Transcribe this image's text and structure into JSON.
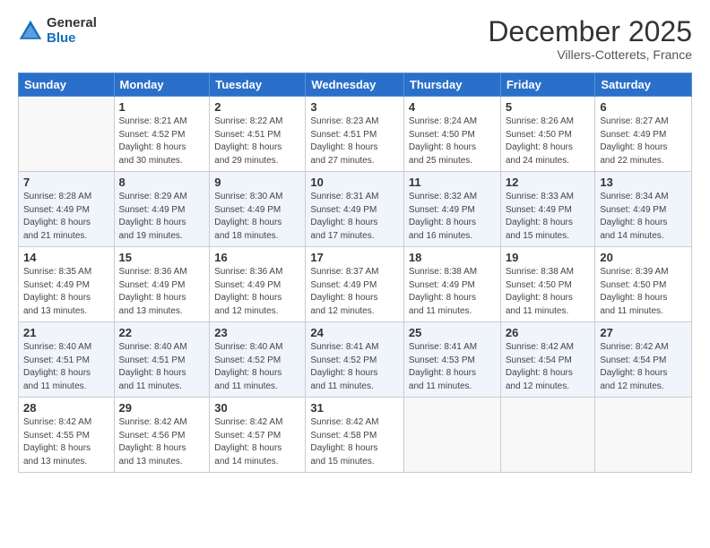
{
  "logo": {
    "general": "General",
    "blue": "Blue"
  },
  "header": {
    "month": "December 2025",
    "location": "Villers-Cotterets, France"
  },
  "days_of_week": [
    "Sunday",
    "Monday",
    "Tuesday",
    "Wednesday",
    "Thursday",
    "Friday",
    "Saturday"
  ],
  "weeks": [
    {
      "days": [
        {
          "num": "",
          "info": ""
        },
        {
          "num": "1",
          "info": "Sunrise: 8:21 AM\nSunset: 4:52 PM\nDaylight: 8 hours\nand 30 minutes."
        },
        {
          "num": "2",
          "info": "Sunrise: 8:22 AM\nSunset: 4:51 PM\nDaylight: 8 hours\nand 29 minutes."
        },
        {
          "num": "3",
          "info": "Sunrise: 8:23 AM\nSunset: 4:51 PM\nDaylight: 8 hours\nand 27 minutes."
        },
        {
          "num": "4",
          "info": "Sunrise: 8:24 AM\nSunset: 4:50 PM\nDaylight: 8 hours\nand 25 minutes."
        },
        {
          "num": "5",
          "info": "Sunrise: 8:26 AM\nSunset: 4:50 PM\nDaylight: 8 hours\nand 24 minutes."
        },
        {
          "num": "6",
          "info": "Sunrise: 8:27 AM\nSunset: 4:49 PM\nDaylight: 8 hours\nand 22 minutes."
        }
      ]
    },
    {
      "days": [
        {
          "num": "7",
          "info": "Sunrise: 8:28 AM\nSunset: 4:49 PM\nDaylight: 8 hours\nand 21 minutes."
        },
        {
          "num": "8",
          "info": "Sunrise: 8:29 AM\nSunset: 4:49 PM\nDaylight: 8 hours\nand 19 minutes."
        },
        {
          "num": "9",
          "info": "Sunrise: 8:30 AM\nSunset: 4:49 PM\nDaylight: 8 hours\nand 18 minutes."
        },
        {
          "num": "10",
          "info": "Sunrise: 8:31 AM\nSunset: 4:49 PM\nDaylight: 8 hours\nand 17 minutes."
        },
        {
          "num": "11",
          "info": "Sunrise: 8:32 AM\nSunset: 4:49 PM\nDaylight: 8 hours\nand 16 minutes."
        },
        {
          "num": "12",
          "info": "Sunrise: 8:33 AM\nSunset: 4:49 PM\nDaylight: 8 hours\nand 15 minutes."
        },
        {
          "num": "13",
          "info": "Sunrise: 8:34 AM\nSunset: 4:49 PM\nDaylight: 8 hours\nand 14 minutes."
        }
      ]
    },
    {
      "days": [
        {
          "num": "14",
          "info": "Sunrise: 8:35 AM\nSunset: 4:49 PM\nDaylight: 8 hours\nand 13 minutes."
        },
        {
          "num": "15",
          "info": "Sunrise: 8:36 AM\nSunset: 4:49 PM\nDaylight: 8 hours\nand 13 minutes."
        },
        {
          "num": "16",
          "info": "Sunrise: 8:36 AM\nSunset: 4:49 PM\nDaylight: 8 hours\nand 12 minutes."
        },
        {
          "num": "17",
          "info": "Sunrise: 8:37 AM\nSunset: 4:49 PM\nDaylight: 8 hours\nand 12 minutes."
        },
        {
          "num": "18",
          "info": "Sunrise: 8:38 AM\nSunset: 4:49 PM\nDaylight: 8 hours\nand 11 minutes."
        },
        {
          "num": "19",
          "info": "Sunrise: 8:38 AM\nSunset: 4:50 PM\nDaylight: 8 hours\nand 11 minutes."
        },
        {
          "num": "20",
          "info": "Sunrise: 8:39 AM\nSunset: 4:50 PM\nDaylight: 8 hours\nand 11 minutes."
        }
      ]
    },
    {
      "days": [
        {
          "num": "21",
          "info": "Sunrise: 8:40 AM\nSunset: 4:51 PM\nDaylight: 8 hours\nand 11 minutes."
        },
        {
          "num": "22",
          "info": "Sunrise: 8:40 AM\nSunset: 4:51 PM\nDaylight: 8 hours\nand 11 minutes."
        },
        {
          "num": "23",
          "info": "Sunrise: 8:40 AM\nSunset: 4:52 PM\nDaylight: 8 hours\nand 11 minutes."
        },
        {
          "num": "24",
          "info": "Sunrise: 8:41 AM\nSunset: 4:52 PM\nDaylight: 8 hours\nand 11 minutes."
        },
        {
          "num": "25",
          "info": "Sunrise: 8:41 AM\nSunset: 4:53 PM\nDaylight: 8 hours\nand 11 minutes."
        },
        {
          "num": "26",
          "info": "Sunrise: 8:42 AM\nSunset: 4:54 PM\nDaylight: 8 hours\nand 12 minutes."
        },
        {
          "num": "27",
          "info": "Sunrise: 8:42 AM\nSunset: 4:54 PM\nDaylight: 8 hours\nand 12 minutes."
        }
      ]
    },
    {
      "days": [
        {
          "num": "28",
          "info": "Sunrise: 8:42 AM\nSunset: 4:55 PM\nDaylight: 8 hours\nand 13 minutes."
        },
        {
          "num": "29",
          "info": "Sunrise: 8:42 AM\nSunset: 4:56 PM\nDaylight: 8 hours\nand 13 minutes."
        },
        {
          "num": "30",
          "info": "Sunrise: 8:42 AM\nSunset: 4:57 PM\nDaylight: 8 hours\nand 14 minutes."
        },
        {
          "num": "31",
          "info": "Sunrise: 8:42 AM\nSunset: 4:58 PM\nDaylight: 8 hours\nand 15 minutes."
        },
        {
          "num": "",
          "info": ""
        },
        {
          "num": "",
          "info": ""
        },
        {
          "num": "",
          "info": ""
        }
      ]
    }
  ]
}
